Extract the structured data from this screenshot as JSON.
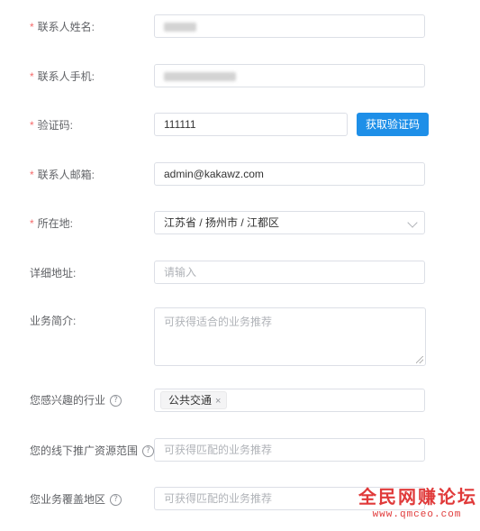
{
  "form": {
    "required_mark": "*",
    "contact_name": {
      "label": "联系人姓名:",
      "value": ""
    },
    "contact_phone": {
      "label": "联系人手机:",
      "value": ""
    },
    "verify_code": {
      "label": "验证码:",
      "value": "111111",
      "button": "获取验证码"
    },
    "contact_email": {
      "label": "联系人邮箱:",
      "value": "admin@kakawz.com"
    },
    "location": {
      "label": "所在地:",
      "value": "江苏省 / 扬州市 / 江都区"
    },
    "address": {
      "label": "详细地址:",
      "placeholder": "请输入"
    },
    "business_intro": {
      "label": "业务简介:",
      "placeholder": "可获得适合的业务推荐"
    },
    "industry": {
      "label": "您感兴趣的行业",
      "help": "?",
      "tag": "公共交通",
      "tag_close": "×"
    },
    "offline_range": {
      "label": "您的线下推广资源范围",
      "help": "?",
      "placeholder": "可获得匹配的业务推荐"
    },
    "coverage": {
      "label": "您业务覆盖地区",
      "help": "?",
      "placeholder": "可获得匹配的业务推荐"
    }
  },
  "watermark": {
    "title": "全民网赚论坛",
    "url": "www.qmceo.com"
  },
  "colors": {
    "accent": "#1e8fe8",
    "required": "#f56c6c",
    "watermark": "#e03a3a"
  }
}
